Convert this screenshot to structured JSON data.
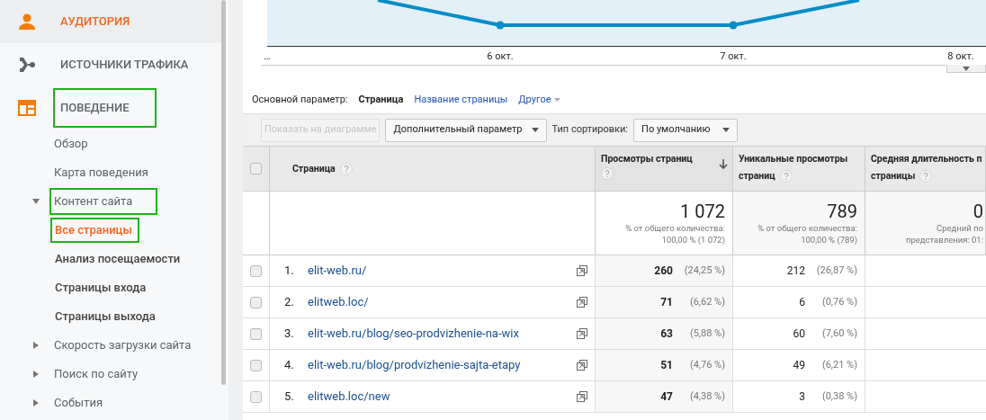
{
  "sidebar": {
    "sections": [
      {
        "label": "АУДИТОРИЯ",
        "selected": true,
        "highlighted": false
      },
      {
        "label": "ИСТОЧНИКИ ТРАФИКА",
        "selected": false,
        "highlighted": false
      },
      {
        "label": "ПОВЕДЕНИЕ",
        "selected": false,
        "highlighted": true,
        "children": [
          {
            "label": "Обзор",
            "kind": "link",
            "selected": false,
            "highlighted": false
          },
          {
            "label": "Карта поведения",
            "kind": "link",
            "selected": false,
            "highlighted": false
          },
          {
            "label": "Контент сайта",
            "kind": "group",
            "expanded": true,
            "highlighted": true,
            "children": [
              {
                "label": "Все страницы",
                "selected": true,
                "highlighted": true
              },
              {
                "label": "Анализ посещаемости",
                "selected": false,
                "highlighted": false
              },
              {
                "label": "Страницы входа",
                "selected": false,
                "highlighted": false
              },
              {
                "label": "Страницы выхода",
                "selected": false,
                "highlighted": false
              }
            ]
          },
          {
            "label": "Скорость загрузки сайта",
            "kind": "group",
            "expanded": false,
            "highlighted": false
          },
          {
            "label": "Поиск по сайту",
            "kind": "group",
            "expanded": false,
            "highlighted": false
          },
          {
            "label": "События",
            "kind": "group",
            "expanded": false,
            "highlighted": false
          }
        ]
      }
    ]
  },
  "chart": {
    "x_labels": [
      "…",
      "6 окт.",
      "7 окт.",
      "8 окт."
    ]
  },
  "primary_dimension": {
    "label": "Основной параметр:",
    "options": [
      {
        "label": "Страница",
        "selected": true
      },
      {
        "label": "Название страницы",
        "selected": false
      }
    ],
    "other": "Другое"
  },
  "toolbar": {
    "plot_button": {
      "label": "Показать на диаграмме",
      "disabled": true
    },
    "secondary_dimension": "Дополнительный параметр",
    "sort_label": "Тип сортировки:",
    "sort_value": "По умолчанию"
  },
  "table": {
    "header_checked": false,
    "columns": [
      {
        "label_lines": [
          "Страница"
        ],
        "sorted": false
      },
      {
        "label_lines": [
          "Просмотры страниц"
        ],
        "sorted": true
      },
      {
        "label_lines": [
          "Уникальные просмотры",
          "страниц"
        ],
        "sorted": false
      },
      {
        "label_lines": [
          "Средняя длительность п",
          "страницы"
        ],
        "sorted": false
      }
    ],
    "totals": [
      {
        "value": "1 072",
        "note": "% от общего количества:\n100,00 % (1 072)"
      },
      {
        "value": "789",
        "note": "% от общего количества:\n100,00 % (789)"
      },
      {
        "value": "0",
        "note": "Средний по\nпредставления: 01:"
      }
    ],
    "rows": [
      {
        "index": "1.",
        "page": "elit-web.ru/",
        "checked": false,
        "views": "260",
        "views_pct": "(24,25 %)",
        "unique": "212",
        "unique_pct": "(26,87 %)"
      },
      {
        "index": "2.",
        "page": "elitweb.loc/",
        "checked": false,
        "views": "71",
        "views_pct": "(6,62 %)",
        "unique": "6",
        "unique_pct": "(0,76 %)"
      },
      {
        "index": "3.",
        "page": "elit-web.ru/blog/seo-prodvizhenie-na-wix",
        "checked": false,
        "views": "63",
        "views_pct": "(5,88 %)",
        "unique": "60",
        "unique_pct": "(7,60 %)"
      },
      {
        "index": "4.",
        "page": "elit-web.ru/blog/prodvizhenie-sajta-etapy",
        "checked": false,
        "views": "51",
        "views_pct": "(4,76 %)",
        "unique": "49",
        "unique_pct": "(6,21 %)"
      },
      {
        "index": "5.",
        "page": "elitweb.loc/new",
        "checked": false,
        "views": "47",
        "views_pct": "(4,38 %)",
        "unique": "3",
        "unique_pct": "(0,38 %)"
      }
    ]
  }
}
